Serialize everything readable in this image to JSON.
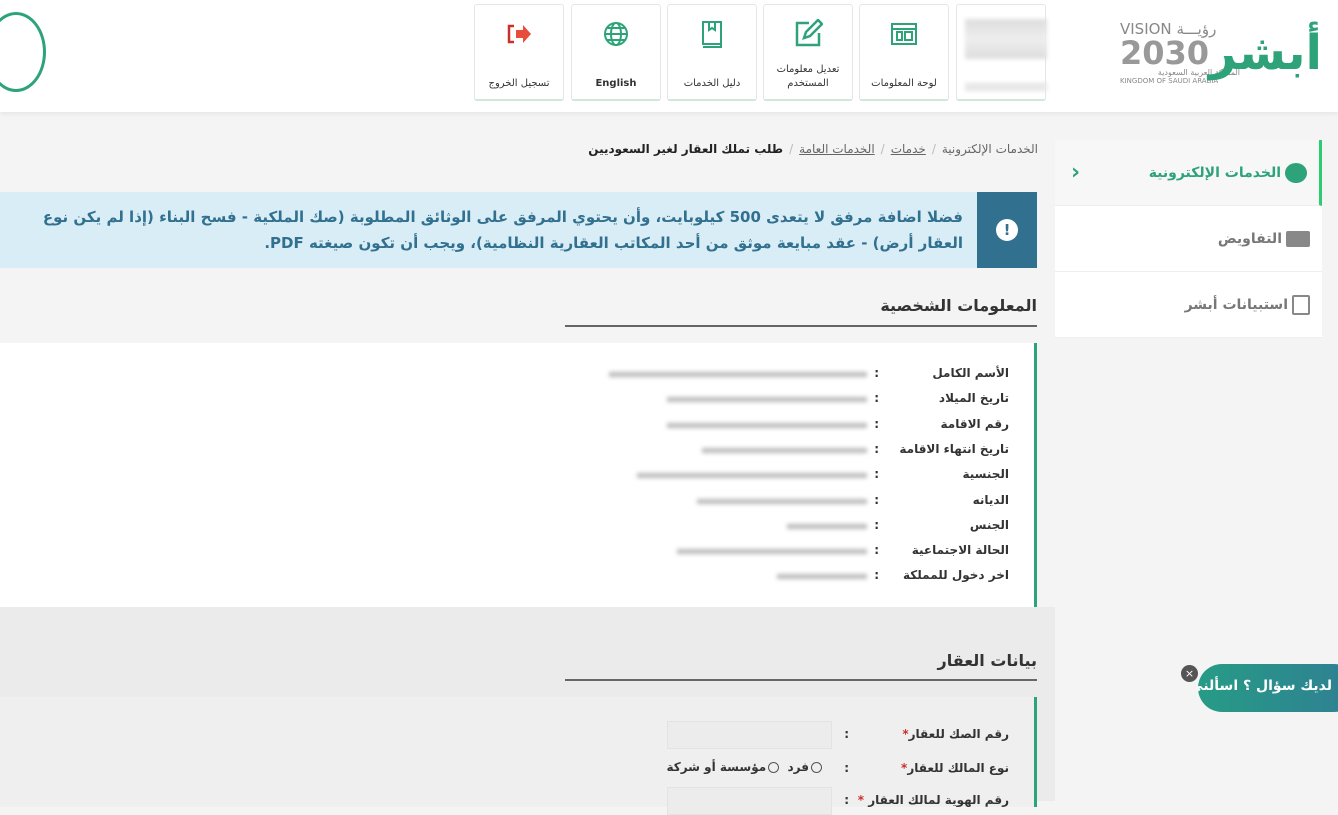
{
  "header": {
    "buttons": [
      {
        "label": "تسجيل الخروج",
        "icon": "logout-icon"
      },
      {
        "label": "English",
        "icon": "globe-icon"
      },
      {
        "label": "دليل الخدمات",
        "icon": "book-icon"
      },
      {
        "label": "تعديل معلومات المستخدم",
        "icon": "edit-icon"
      },
      {
        "label": "لوحة المعلومات",
        "icon": "dashboard-icon"
      }
    ],
    "vision": {
      "top": "VISION رؤيـــة",
      "year": "2030",
      "ar": "المملكة العربية السعودية",
      "en": "KINGDOM OF SAUDI ARABIA"
    },
    "logo": "أبشر"
  },
  "sidebar": {
    "items": [
      {
        "label": "الخدمات الإلكترونية",
        "active": true
      },
      {
        "label": "التفاويض"
      },
      {
        "label": "استبيانات أبشر"
      }
    ]
  },
  "breadcrumb": [
    "الخدمات الإلكترونية",
    "خدمات",
    "الخدمات العامة",
    "طلب تملك العقار لغير السعوديين"
  ],
  "alert": {
    "text": "فضلا اضافة مرفق لا يتعدى 500 كيلوبايت، وأن يحتوي المرفق على الوثائق المطلوبة (صك الملكية - فسح البناء (إذا لم يكن نوع العقار أرض) - عقد مبايعة موثق من أحد المكاتب العقارية النظامية)، ويجب أن تكون صيغته PDF."
  },
  "personal": {
    "title": "المعلومات الشخصية",
    "rows": [
      "الأسم الكامل",
      "تاريخ الميلاد",
      "رقم الاقامة",
      "تاريخ انتهاء الاقامة",
      "الجنسية",
      "الديانه",
      "الجنس",
      "الحالة الاجتماعية",
      "اخر دخول للمملكة"
    ]
  },
  "property": {
    "title": "بيانات العقار",
    "deed_label": "رقم الصك للعقار",
    "owner_type_label": "نوع المالك للعقار",
    "owner_options": [
      "فرد",
      "مؤسسة أو شركة"
    ],
    "owner_id_label": "رقم الهوية لمالك العقار"
  },
  "colon": ":",
  "chat": {
    "label": "لديك سؤال ؟ اسألني",
    "label_visible": "ك سؤال ؟ اسألني",
    "close": "×"
  },
  "colors": {
    "brand": "#2ea37a",
    "alert_bg": "#d9edf6",
    "alert_icon": "#31708f"
  }
}
